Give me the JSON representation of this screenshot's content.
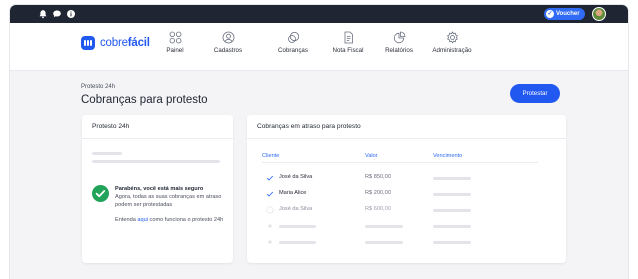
{
  "topbar": {
    "icons": [
      "bell-icon",
      "chat-icon",
      "info-icon"
    ],
    "voucher_label": "Voucher"
  },
  "brand": {
    "prefix": "cobre",
    "suffix": "fácil",
    "color": "#2158f0"
  },
  "nav": {
    "items": [
      {
        "label": "Painel",
        "icon": "grid-icon"
      },
      {
        "label": "Cadastros",
        "icon": "user-icon"
      },
      {
        "label": "Cobranças",
        "icon": "coins-icon"
      },
      {
        "label": "Nota Fiscal",
        "icon": "document-icon"
      },
      {
        "label": "Relatórios",
        "icon": "chart-icon"
      },
      {
        "label": "Administração",
        "icon": "gear-icon"
      }
    ]
  },
  "page": {
    "breadcrumb": "Protesto 24h",
    "title": "Cobranças para protesto",
    "primary_button": "Protestar"
  },
  "left_card": {
    "title": "Protesto 24h",
    "success_title": "Parabéns, você está mais seguro",
    "success_body": "Agora, todas as suas cobranças em atraso podem ser protestadas",
    "help_prefix": "Entenda ",
    "help_link": "aqui",
    "help_suffix": " como funciona o protesto 24h"
  },
  "right_card": {
    "title": "Cobranças em atraso para protesto",
    "columns": [
      "Cliente",
      "Valor",
      "Vencimento"
    ],
    "rows": [
      {
        "name": "José da Silva",
        "value": "R$ 850,00",
        "checked": true
      },
      {
        "name": "Maria Alice",
        "value": "R$ 200,00",
        "checked": true
      },
      {
        "name": "José da Silva",
        "value": "R$ 600,00",
        "checked": false
      }
    ]
  },
  "colors": {
    "accent": "#2158f0",
    "success": "#22a35a",
    "topbar": "#1f2532"
  }
}
